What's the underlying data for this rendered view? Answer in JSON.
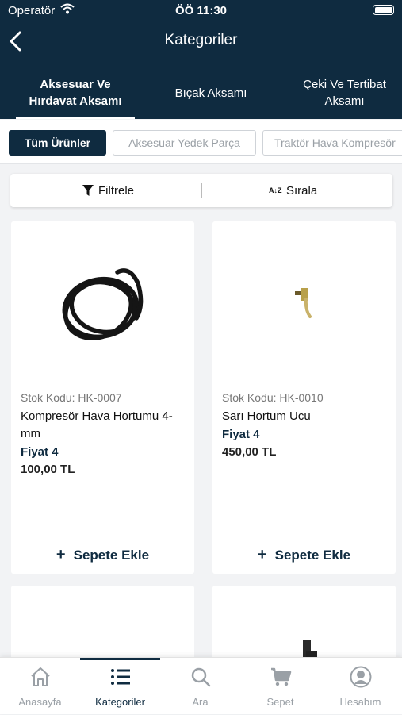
{
  "status_bar": {
    "carrier": "Operatör",
    "time": "ÖÖ 11:30"
  },
  "navbar": {
    "title": "Kategoriler"
  },
  "tabs": [
    {
      "line1": "Aksesuar Ve",
      "line2": "Hırdavat Aksamı",
      "active": true
    },
    {
      "line1": "Bıçak Aksamı",
      "line2": "",
      "active": false
    },
    {
      "line1": "Çeki Ve Tertibat",
      "line2": "Aksamı",
      "active": false
    }
  ],
  "chips": [
    "Tüm Ürünler",
    "Aksesuar Yedek Parça",
    "Traktör Hava Kompresör"
  ],
  "toolbar": {
    "filter": "Filtrele",
    "sort": "Sırala",
    "sort_icon_glyph": "A↓Z"
  },
  "products": [
    {
      "sku": "Stok Kodu: HK-0007",
      "name": "Kompresör Hava Hortumu 4-mm",
      "price_label": "Fiyat 4",
      "price": "100,00 TL",
      "add_label": "Sepete Ekle",
      "image_icon": "hose-image"
    },
    {
      "sku": "Stok Kodu: HK-0010",
      "name": "Sarı Hortum Ucu",
      "price_label": "Fiyat 4",
      "price": "450,00 TL",
      "add_label": "Sepete Ekle",
      "image_icon": "hose-tip-image"
    }
  ],
  "bottom_nav": [
    {
      "label": "Anasayfa",
      "icon": "home-icon",
      "active": false
    },
    {
      "label": "Kategoriler",
      "icon": "list-icon",
      "active": true
    },
    {
      "label": "Ara",
      "icon": "search-icon",
      "active": false
    },
    {
      "label": "Sepet",
      "icon": "cart-icon",
      "active": false
    },
    {
      "label": "Hesabım",
      "icon": "account-icon",
      "active": false
    }
  ],
  "colors": {
    "brand": "#0f2b40",
    "inactive": "#9aa0a6"
  }
}
